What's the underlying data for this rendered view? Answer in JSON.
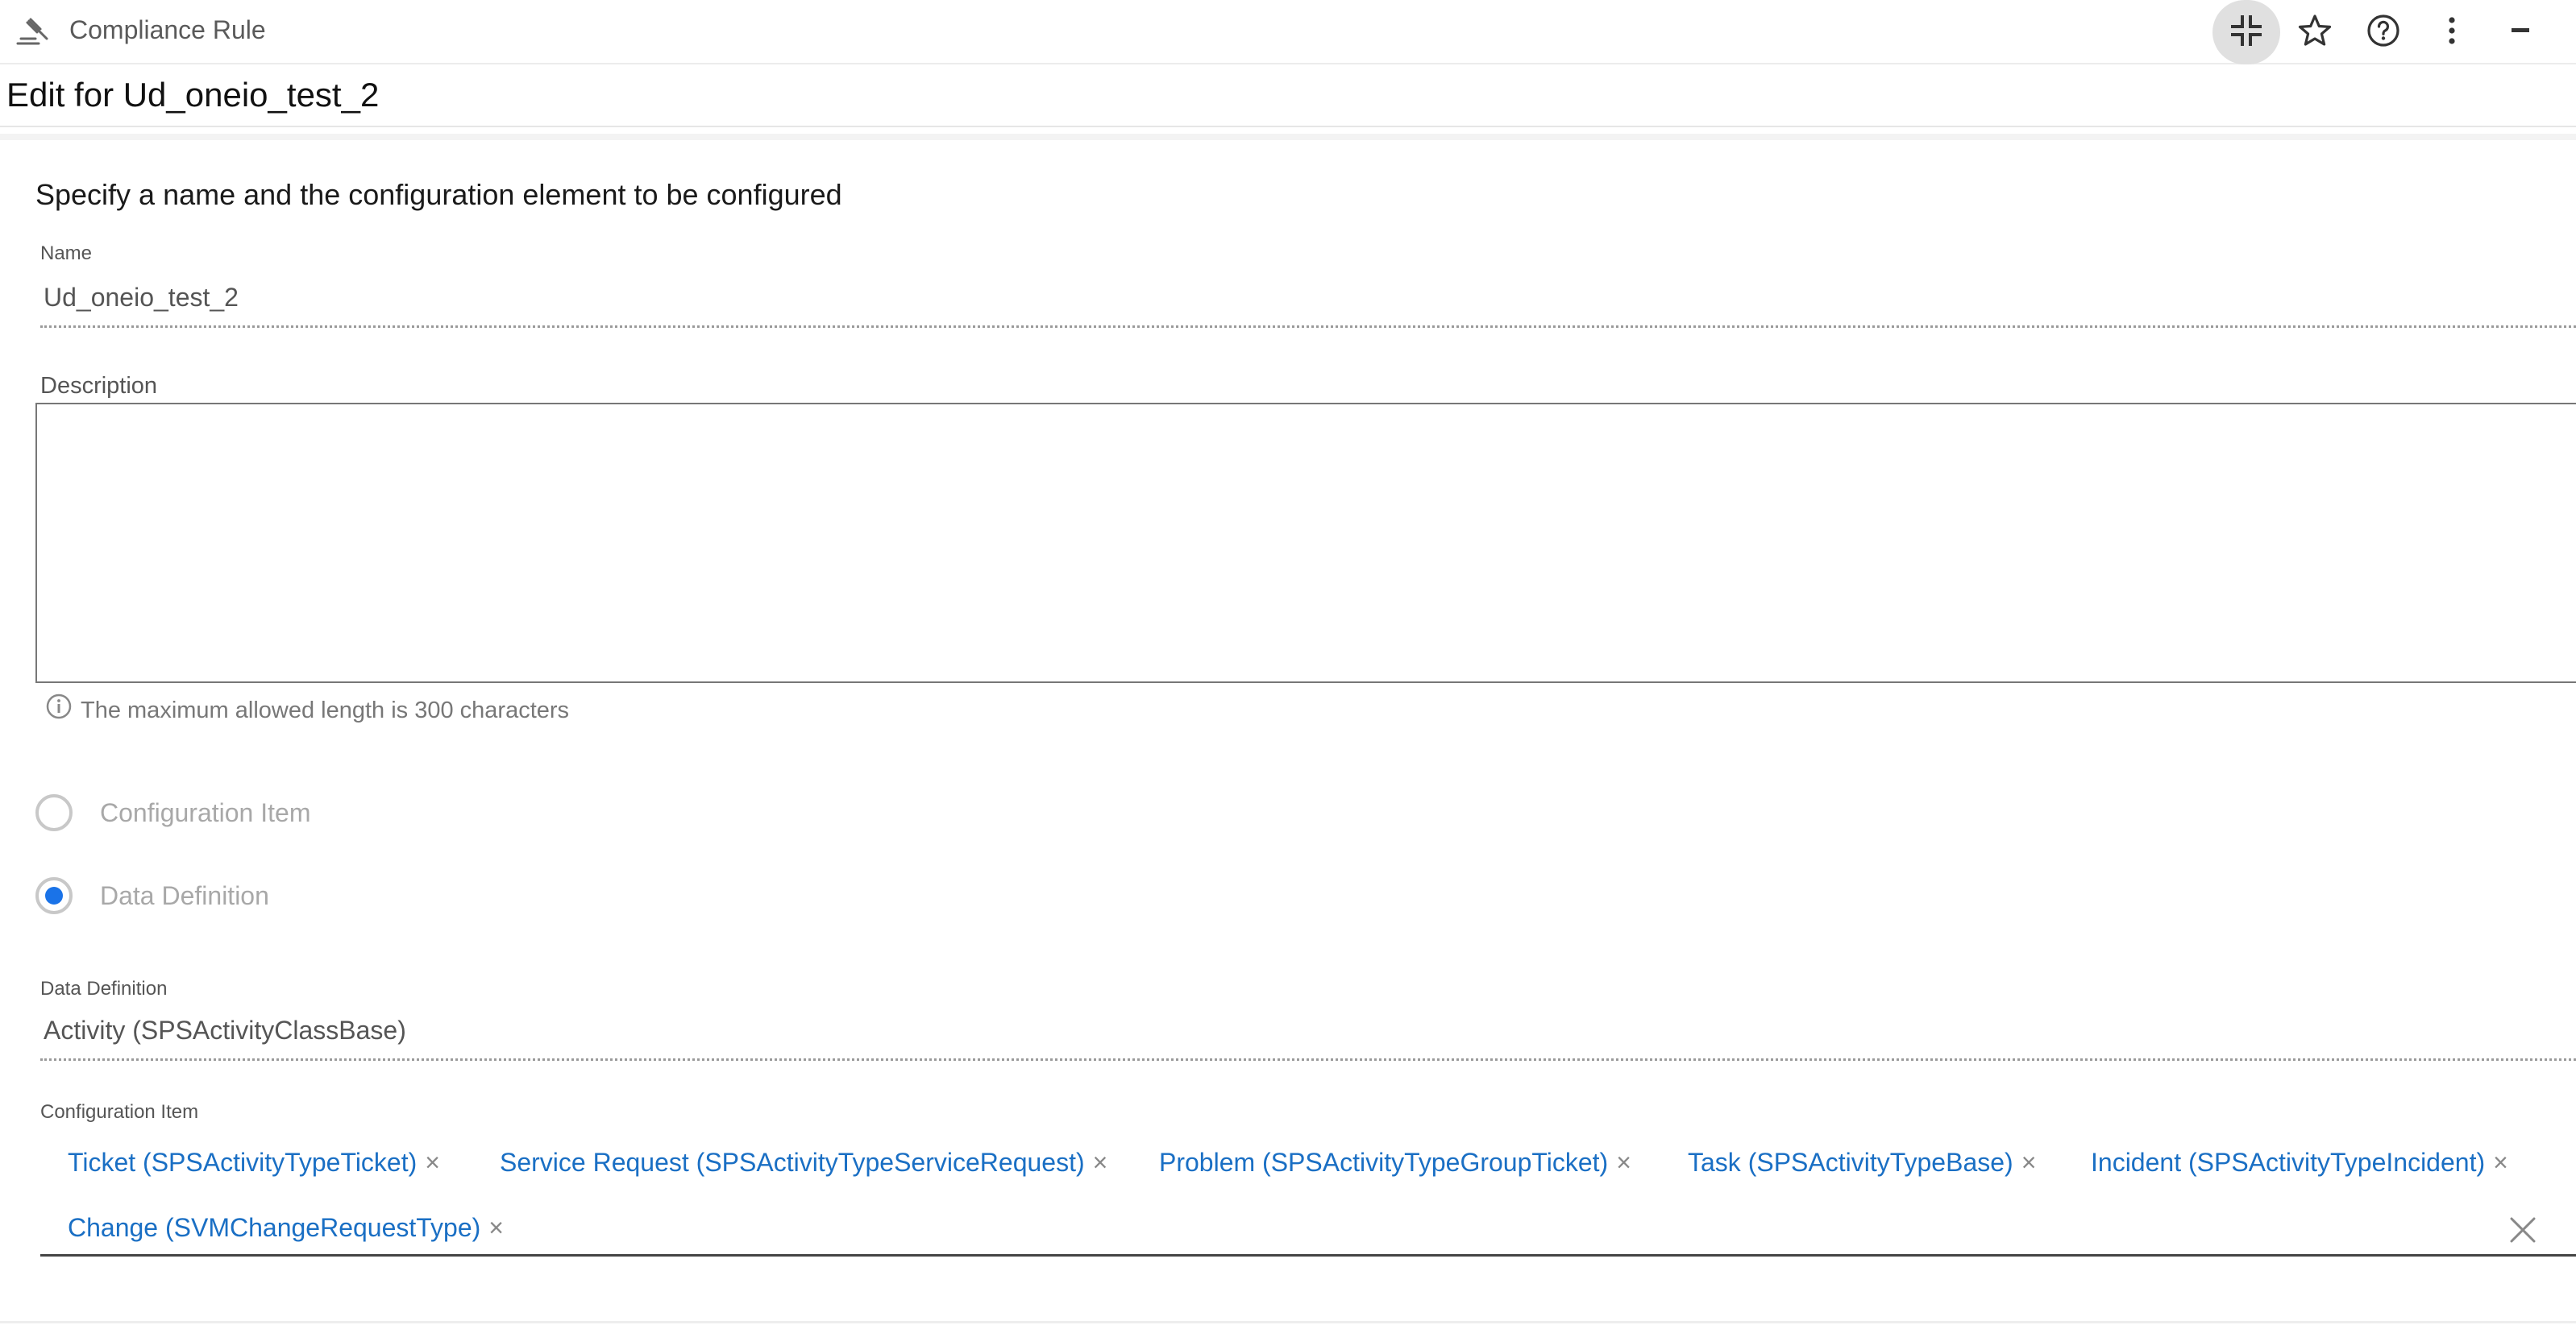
{
  "header": {
    "app_title": "Compliance Rule",
    "app_icon": "gavel-icon",
    "actions": [
      {
        "name": "collapse-icon"
      },
      {
        "name": "star-icon"
      },
      {
        "name": "help-icon"
      },
      {
        "name": "more-vertical-icon"
      },
      {
        "name": "minimize-icon"
      }
    ]
  },
  "subheader": {
    "title": "Edit for Ud_oneio_test_2"
  },
  "form": {
    "section_title": "Specify a name and the configuration element to be configured",
    "name_label": "Name",
    "name_value": "Ud_oneio_test_2",
    "description_label": "Description",
    "description_value": "",
    "description_hint": "The maximum allowed length is 300 characters",
    "options": [
      {
        "label": "Configuration Item",
        "checked": false
      },
      {
        "label": "Data Definition",
        "checked": true
      }
    ],
    "data_definition_label": "Data Definition",
    "data_definition_value": "Activity (SPSActivityClassBase)",
    "config_item_label": "Configuration Item",
    "config_items": [
      "Ticket (SPSActivityTypeTicket)",
      "Service Request (SPSActivityTypeServiceRequest)",
      "Problem (SPSActivityTypeGroupTicket)",
      "Task (SPSActivityTypeBase)",
      "Incident (SPSActivityTypeIncident)",
      "Change (SVMChangeRequestType)"
    ],
    "chip_remove_glyph": "×"
  },
  "colors": {
    "accent": "#1a73e8",
    "chip_text": "#1a6fc4"
  }
}
